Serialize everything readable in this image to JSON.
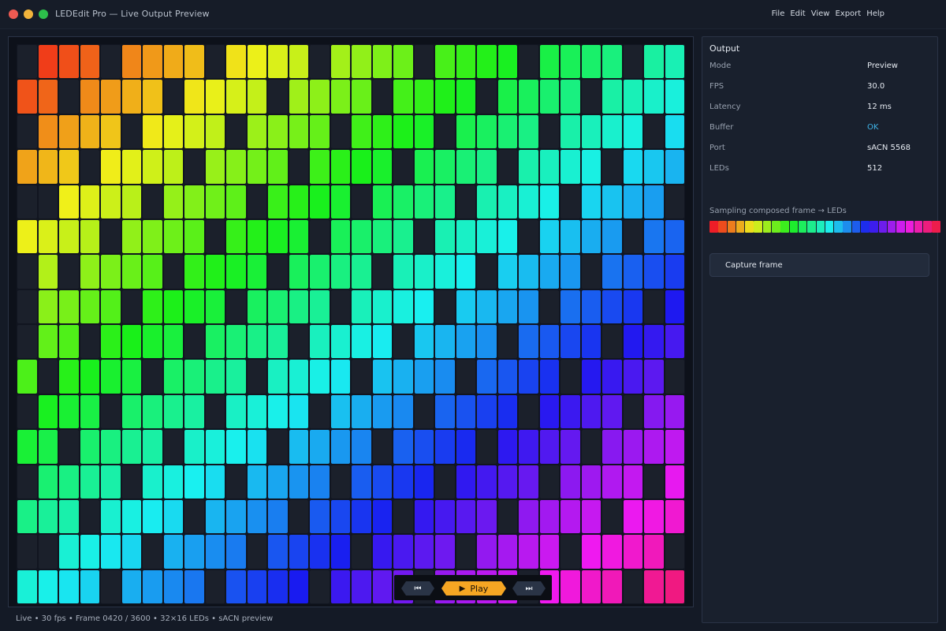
{
  "app": {
    "title": "LEDEdit Pro — Live Output Preview",
    "menu": [
      "File",
      "Edit",
      "View",
      "Export",
      "Help"
    ]
  },
  "colors": {
    "accent": "#f6a623",
    "background": "#141a26",
    "status_ok": "#3fb4e8",
    "led_off": "#1b202b"
  },
  "grid": {
    "columns": 32,
    "rows": 16,
    "hue_step_per_column": 5.1,
    "hue_step_per_row": 11.2
  },
  "transport": {
    "prev_icon": "skip-back-icon",
    "prev_glyph": "⏮",
    "play_icon": "play-icon",
    "play_glyph": "▶",
    "play_label": "Play",
    "next_icon": "skip-forward-icon",
    "next_glyph": "⏭"
  },
  "statusbar": {
    "text": "Live • 30 fps  •  Frame 0420 / 3600  •  32×16 LEDs  •  sACN preview"
  },
  "sidebar": {
    "title": "Output",
    "properties": [
      {
        "key": "Mode",
        "value": "Preview"
      },
      {
        "key": "FPS",
        "value": "30.0"
      },
      {
        "key": "Latency",
        "value": "12 ms"
      },
      {
        "key": "Buffer",
        "value": "OK"
      },
      {
        "key": "Port",
        "value": "sACN 5568"
      },
      {
        "key": "LEDs",
        "value": "512"
      }
    ],
    "sampling_label": "Sampling composed frame → LEDs",
    "swatch_count": 26,
    "capture_label": "Capture frame"
  }
}
